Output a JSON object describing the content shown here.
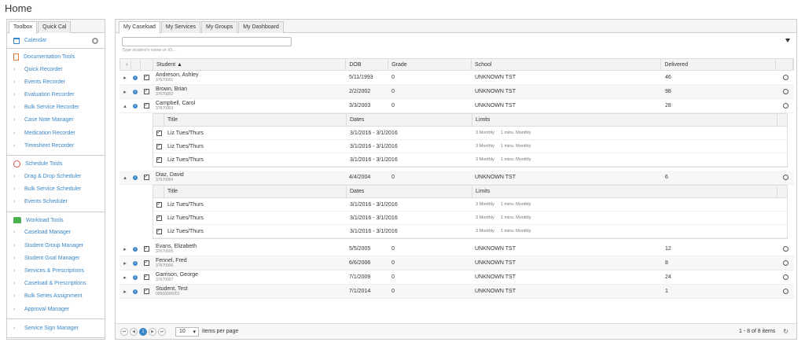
{
  "page": {
    "title": "Home"
  },
  "left": {
    "tabs": [
      "Toolbox",
      "Quick Cal"
    ],
    "calendar": "Calendar",
    "sections": [
      {
        "title": "Documentation Tools",
        "icon": "document-icon",
        "items": [
          "Quick Recorder",
          "Events Recorder",
          "Evaluation Recorder",
          "Bulk Service Recorder",
          "Case Note Manager",
          "Medication Recorder",
          "Timesheet Recorder"
        ]
      },
      {
        "title": "Schedule Tools",
        "icon": "clock-icon",
        "items": [
          "Drag & Drop Scheduler",
          "Bulk Service Scheduler",
          "Events Scheduler"
        ]
      },
      {
        "title": "Workload Tools",
        "icon": "users-icon",
        "items": [
          "Caseload Manager",
          "Student Group Manager",
          "Student Goal Manager",
          "Services & Prescriptions",
          "Caseload & Prescriptions",
          "Bulk Series Assignment",
          "Approval Manager"
        ]
      },
      {
        "title": "",
        "icon": "",
        "items": [
          "Service Sign Manager"
        ]
      }
    ]
  },
  "main": {
    "tabs": [
      "My Caseload",
      "My Services",
      "My Groups",
      "My Dashboard"
    ],
    "search": {
      "value": "",
      "hint": "Type student's name or ID...."
    },
    "columns": {
      "student": "Student ▲",
      "dob": "DOB",
      "grade": "Grade",
      "school": "School",
      "delivered": "Delivered"
    },
    "sub_columns": {
      "title": "Title",
      "dates": "Dates",
      "limits": "Limits"
    },
    "rows": [
      {
        "name": "Andreson, Ashley",
        "id": "37670001",
        "dob": "5/11/1993",
        "grade": "0",
        "school": "UNKNOWN TST",
        "delivered": "46",
        "expanded": false
      },
      {
        "name": "Brown, Brian",
        "id": "37670002",
        "dob": "2/2/2002",
        "grade": "0",
        "school": "UNKNOWN TST",
        "delivered": "98",
        "expanded": false
      },
      {
        "name": "Campbell, Carol",
        "id": "37670003",
        "dob": "3/3/2003",
        "grade": "0",
        "school": "UNKNOWN TST",
        "delivered": "28",
        "expanded": true,
        "services": [
          {
            "title": "Liz Tues/Thurs",
            "dates": "3/1/2016 - 3/1/2016",
            "lim_a": "3 Monthly",
            "lim_b": "1 mins. Monthly"
          },
          {
            "title": "Liz Tues/Thurs",
            "dates": "3/1/2016 - 3/1/2016",
            "lim_a": "3 Monthly",
            "lim_b": "1 mins. Monthly"
          },
          {
            "title": "Liz Tues/Thurs",
            "dates": "3/1/2016 - 3/1/2016",
            "lim_a": "3 Monthly",
            "lim_b": "1 mins. Monthly"
          }
        ]
      },
      {
        "name": "Diaz, David",
        "id": "37670004",
        "dob": "4/4/2004",
        "grade": "0",
        "school": "UNKNOWN TST",
        "delivered": "6",
        "expanded": true,
        "services": [
          {
            "title": "Liz Tues/Thurs",
            "dates": "3/1/2016 - 3/1/2016",
            "lim_a": "3 Monthly",
            "lim_b": "1 mins. Monthly"
          },
          {
            "title": "Liz Tues/Thurs",
            "dates": "3/1/2016 - 3/1/2016",
            "lim_a": "3 Monthly",
            "lim_b": "1 mins. Monthly"
          },
          {
            "title": "Liz Tues/Thurs",
            "dates": "3/1/2016 - 3/1/2016",
            "lim_a": "3 Monthly",
            "lim_b": "1 mins. Monthly"
          }
        ]
      },
      {
        "name": "Evans, Elizabeth",
        "id": "37670005",
        "dob": "5/5/2005",
        "grade": "0",
        "school": "UNKNOWN TST",
        "delivered": "12",
        "expanded": false
      },
      {
        "name": "Fennel, Fred",
        "id": "37670006",
        "dob": "6/6/2006",
        "grade": "0",
        "school": "UNKNOWN TST",
        "delivered": "8",
        "expanded": false
      },
      {
        "name": "Garrison, George",
        "id": "37670007",
        "dob": "7/1/2009",
        "grade": "0",
        "school": "UNKNOWN TST",
        "delivered": "24",
        "expanded": false
      },
      {
        "name": "Student, Test",
        "id": "00000000001",
        "dob": "7/1/2014",
        "grade": "0",
        "school": "UNKNOWN TST",
        "delivered": "1",
        "expanded": false
      }
    ],
    "pager": {
      "current": "1",
      "page_size": "10",
      "size_label": "items per page",
      "count": "1 - 8 of 8 items"
    }
  }
}
